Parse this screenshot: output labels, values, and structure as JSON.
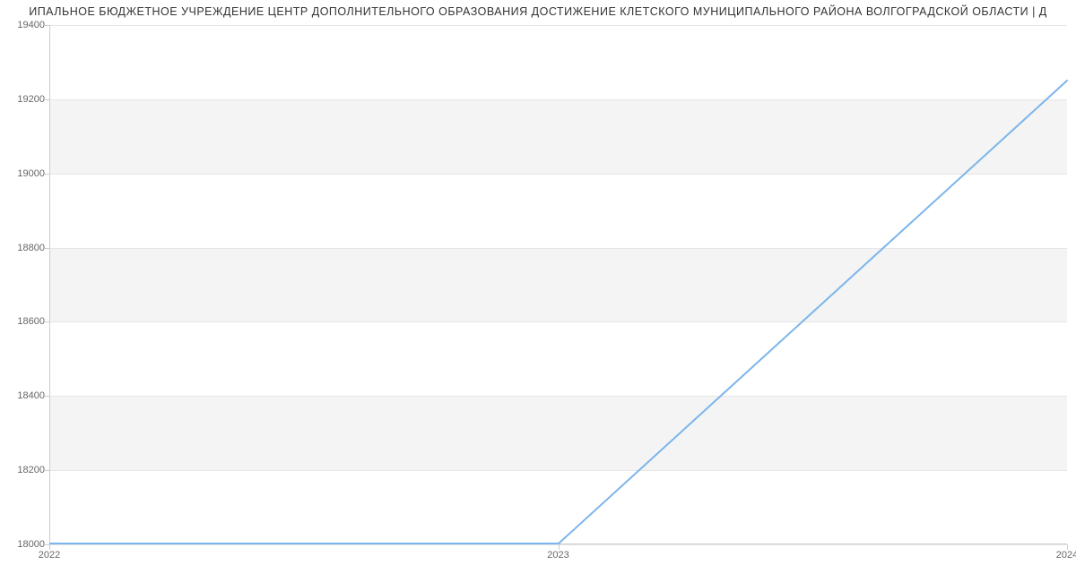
{
  "chart_data": {
    "type": "line",
    "title": "ИПАЛЬНОЕ БЮДЖЕТНОЕ УЧРЕЖДЕНИЕ ЦЕНТР ДОПОЛНИТЕЛЬНОГО ОБРАЗОВАНИЯ ДОСТИЖЕНИЕ КЛЕТСКОГО МУНИЦИПАЛЬНОГО РАЙОНА ВОЛГОГРАДСКОЙ ОБЛАСТИ | Д",
    "xlabel": "",
    "ylabel": "",
    "x": [
      2022,
      2023,
      2024
    ],
    "values": [
      18000,
      18000,
      19250
    ],
    "ylim": [
      18000,
      19400
    ],
    "xlim": [
      2022,
      2024
    ],
    "y_ticks": [
      18000,
      18200,
      18400,
      18600,
      18800,
      19000,
      19200,
      19400
    ],
    "x_ticks": [
      2022,
      2023,
      2024
    ],
    "series_color": "#7cb5ec",
    "grid": true
  }
}
